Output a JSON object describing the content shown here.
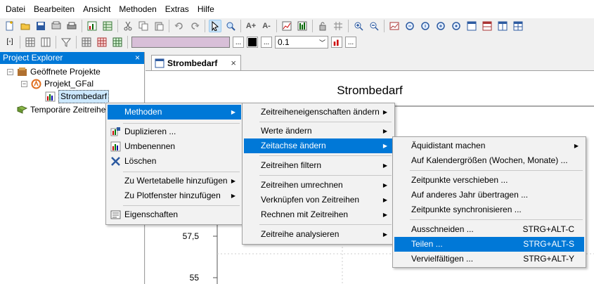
{
  "menubar": {
    "items": [
      "Datei",
      "Bearbeiten",
      "Ansicht",
      "Methoden",
      "Extras",
      "Hilfe"
    ]
  },
  "toolbar": {
    "line_width_value": "0.1",
    "ellipsis_label": "..."
  },
  "explorer": {
    "title": "Project Explorer",
    "close_glyph": "×",
    "nodes": {
      "root": "Geöffnete Projekte",
      "project": "Projekt_GFal",
      "series": "Strombedarf",
      "temp": "Temporäre Zeitreihen"
    }
  },
  "tab": {
    "label": "Strombedarf",
    "close_glyph": "×"
  },
  "chart_data": {
    "type": "line",
    "title": "Strombedarf",
    "y_tick_labels": [
      "57,5",
      "55"
    ],
    "series": []
  },
  "context_menu": {
    "items": [
      {
        "label": "Methoden",
        "submenu": true,
        "highlighted": true
      },
      {
        "label": "Duplizieren ...",
        "icon": "duplicate-icon"
      },
      {
        "label": "Umbenennen",
        "icon": "rename-icon"
      },
      {
        "label": "Löschen",
        "icon": "delete-icon"
      },
      {
        "label": "Zu Wertetabelle hinzufügen",
        "submenu": true
      },
      {
        "label": "Zu Plotfenster hinzufügen",
        "submenu": true
      },
      {
        "label": "Eigenschaften",
        "icon": "properties-icon"
      }
    ]
  },
  "methoden_menu": {
    "items": [
      {
        "label": "Zeitreiheneigenschaften ändern",
        "submenu": true
      },
      {
        "label": "Werte ändern",
        "submenu": true
      },
      {
        "label": "Zeitachse ändern",
        "submenu": true,
        "highlighted": true
      },
      {
        "label": "Zeitreihen filtern",
        "submenu": true
      },
      {
        "label": "Zeitreihen umrechnen",
        "submenu": true
      },
      {
        "label": "Verknüpfen von Zeitreihen",
        "submenu": true
      },
      {
        "label": "Rechnen mit Zeitreihen",
        "submenu": true
      },
      {
        "label": "Zeitreihe analysieren",
        "submenu": true
      }
    ]
  },
  "zeitachse_menu": {
    "items": [
      {
        "label": "Äquidistant machen",
        "submenu": true
      },
      {
        "label": "Auf Kalendergrößen (Wochen, Monate) ..."
      },
      {
        "label": "Zeitpunkte verschieben ..."
      },
      {
        "label": "Auf anderes Jahr übertragen ..."
      },
      {
        "label": "Zeitpunkte synchronisieren ..."
      },
      {
        "label": "Ausschneiden ...",
        "shortcut": "STRG+ALT-C"
      },
      {
        "label": "Teilen ...",
        "shortcut": "STRG+ALT-S",
        "highlighted": true
      },
      {
        "label": "Vervielfältigen ...",
        "shortcut": "STRG+ALT-Y"
      }
    ]
  },
  "colors": {
    "highlight": "#0078d7",
    "menu_bg": "#f2f2f2",
    "color_swatch": "#d8bfd8",
    "title_bar": "#0078d7"
  }
}
